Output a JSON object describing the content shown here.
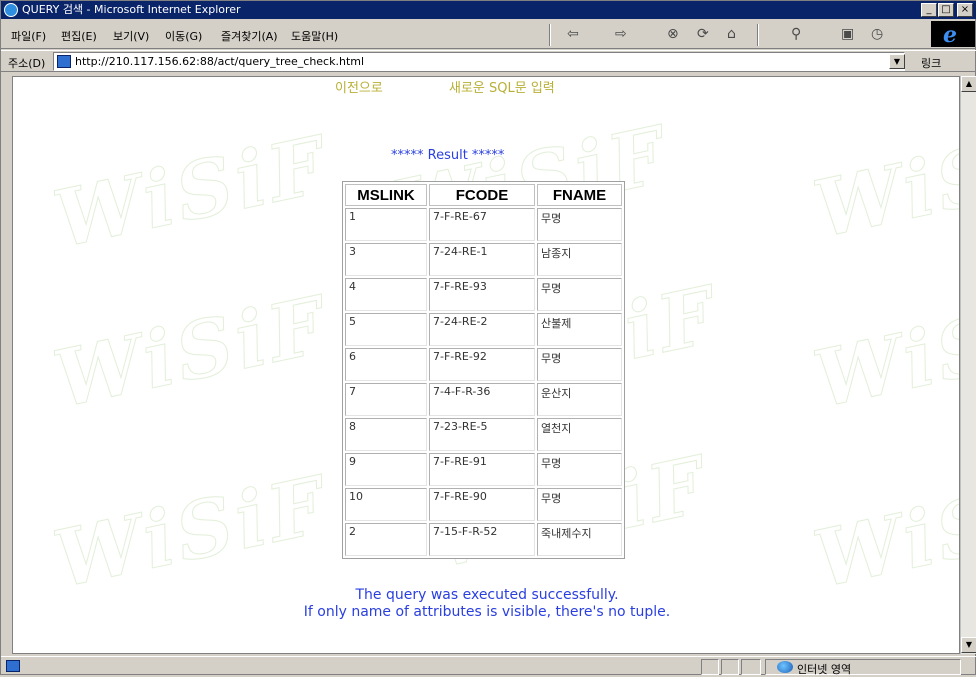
{
  "window": {
    "title": "QUERY 검색 - Microsoft Internet Explorer",
    "controls": [
      "_",
      "□",
      "×"
    ]
  },
  "menu": [
    "파일(F)",
    "편집(E)",
    "보기(V)",
    "이동(G)",
    "즐겨찾기(A)",
    "도움말(H)"
  ],
  "toolbar": {
    "back": "⇦",
    "forward": "⇨",
    "stop": "⊗",
    "refresh": "⟳",
    "home": "⌂",
    "search": "⚲",
    "favorites": "▣",
    "history": "◷"
  },
  "address": {
    "label": "주소(D)",
    "url": "http://210.117.156.62:88/act/query_tree_check.html",
    "go_label": "링크"
  },
  "page": {
    "prev_link": "이전으로",
    "new_sql_link": "새로운 SQL문 입력",
    "result_title": "***** Result *****",
    "watermark": "WiSiF",
    "table": {
      "headers": [
        "MSLINK",
        "FCODE",
        "FNAME"
      ],
      "rows": [
        [
          "1",
          "7-F-RE-67",
          "무명"
        ],
        [
          "3",
          "7-24-RE-1",
          "남종지"
        ],
        [
          "4",
          "7-F-RE-93",
          "무명"
        ],
        [
          "5",
          "7-24-RE-2",
          "산불제"
        ],
        [
          "6",
          "7-F-RE-92",
          "무명"
        ],
        [
          "7",
          "7-4-F-R-36",
          "운산지"
        ],
        [
          "8",
          "7-23-RE-5",
          "열천지"
        ],
        [
          "9",
          "7-F-RE-91",
          "무명"
        ],
        [
          "10",
          "7-F-RE-90",
          "무명"
        ],
        [
          "2",
          "7-15-F-R-52",
          "죽내제수지"
        ]
      ]
    },
    "message_line1": "The query was executed successfully.",
    "message_line2": "If only name of attributes is visible, there's no tuple."
  },
  "status": {
    "zone": "인터넷 영역"
  }
}
